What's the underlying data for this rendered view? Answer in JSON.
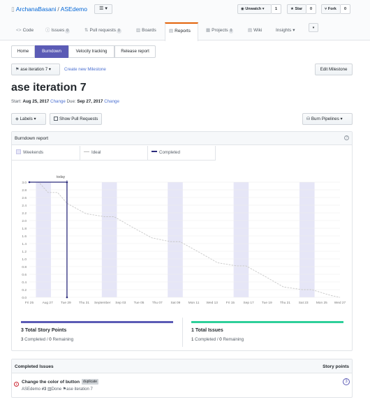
{
  "repo": {
    "owner": "ArchanaBasani",
    "separator": "/",
    "name": "ASEdemo",
    "menu_icon": "list-icon",
    "unwatch_label": "Unwatch ▾",
    "unwatch_count": "1",
    "star_label": "Star",
    "star_count": "0",
    "fork_label": "Fork",
    "fork_count": "0"
  },
  "nav_tabs": [
    {
      "label": "Code",
      "icon": "<>",
      "count": ""
    },
    {
      "label": "Issues",
      "icon": "ⓘ",
      "count": "0"
    },
    {
      "label": "Pull requests",
      "icon": "⇅",
      "count": "0"
    },
    {
      "label": "Boards",
      "icon": "▥",
      "count": ""
    },
    {
      "label": "Reports",
      "icon": "▤",
      "count": ""
    },
    {
      "label": "Projects",
      "icon": "▦",
      "count": "0"
    },
    {
      "label": "Wiki",
      "icon": "▤",
      "count": ""
    },
    {
      "label": "Insights ▾",
      "icon": "",
      "count": ""
    }
  ],
  "sub_tabs": [
    "Home",
    "Burndown",
    "Velocity tracking",
    "Release report"
  ],
  "milestone": {
    "selector_label": "ase iteration 7",
    "create_link": "Create new Milestone",
    "edit_button": "Edit Milestone",
    "title": "ase iteration 7",
    "start_label": "Start:",
    "start_date": "Aug 25, 2017",
    "due_label": "Due:",
    "due_date": "Sep 27, 2017",
    "change_label": "Change"
  },
  "filters": {
    "labels_button": "Labels",
    "show_prs_button": "Show Pull Requests",
    "pipelines_button": "Burn Pipelines"
  },
  "burndown": {
    "title": "Burndown report",
    "legend_weekends": "Weekends",
    "legend_ideal": "Ideal",
    "legend_completed": "Completed",
    "today_label": "today"
  },
  "chart_data": {
    "type": "line",
    "y_ticks": [
      "3.0",
      "2.8",
      "2.6",
      "2.4",
      "2.2",
      "2.0",
      "1.8",
      "1.6",
      "1.4",
      "1.2",
      "1.0",
      "0.8",
      "0.6",
      "0.4",
      "0.2",
      "0.0"
    ],
    "x_labels": [
      "Fri 25",
      "Aug 27",
      "Tue 29",
      "Thu 31",
      "September",
      "Sep 03",
      "Tue 05",
      "Thu 07",
      "Sat 09",
      "Mon 11",
      "Wed 13",
      "Fri 15",
      "Sep 17",
      "Tue 19",
      "Thu 21",
      "Sat 23",
      "Mon 25",
      "Wed 27"
    ],
    "ylim": [
      0,
      3
    ],
    "x_range_days": [
      0,
      33
    ],
    "today_day": 4,
    "weekend_days": [
      1,
      8,
      15,
      22,
      29
    ],
    "series": [
      {
        "name": "Ideal",
        "points": [
          [
            0,
            3
          ],
          [
            1,
            3
          ],
          [
            2,
            2.73
          ],
          [
            3,
            2.73
          ],
          [
            4,
            2.45
          ],
          [
            6,
            2.18
          ],
          [
            8,
            2.1
          ],
          [
            9,
            2.1
          ],
          [
            11,
            1.82
          ],
          [
            13,
            1.55
          ],
          [
            15,
            1.45
          ],
          [
            16,
            1.45
          ],
          [
            18,
            1.18
          ],
          [
            20,
            0.9
          ],
          [
            22,
            0.82
          ],
          [
            23,
            0.82
          ],
          [
            25,
            0.55
          ],
          [
            27,
            0.27
          ],
          [
            29,
            0.2
          ],
          [
            30,
            0.2
          ],
          [
            32,
            0.05
          ],
          [
            33,
            0
          ]
        ],
        "color": "#c8c8c8"
      },
      {
        "name": "Completed",
        "points": [
          [
            0,
            3
          ],
          [
            4,
            3
          ],
          [
            4,
            0
          ]
        ],
        "color": "#2c2c7c"
      }
    ],
    "grid": true
  },
  "summary": {
    "story_points_title": "3 Total Story Points",
    "story_completed_num": "3",
    "story_completed_text": " Completed / ",
    "story_remaining_num": "0",
    "story_remaining_text": " Remaining",
    "issues_title": "1 Total Issues",
    "issues_completed_num": "1",
    "issues_completed_text": " Completed / ",
    "issues_remaining_num": "0",
    "issues_remaining_text": " Remaining",
    "story_color": "#5b5bb5",
    "issues_color": "#2ecf9a"
  },
  "completed_issues": {
    "header": "Completed Issues",
    "points_header": "Story points",
    "items": [
      {
        "title": "Change the color of button",
        "label": "duplicate",
        "repo": "ASEdemo",
        "number": "#3",
        "pipeline": "Done",
        "milestone": "ase iteration 7",
        "points": "3"
      }
    ]
  }
}
